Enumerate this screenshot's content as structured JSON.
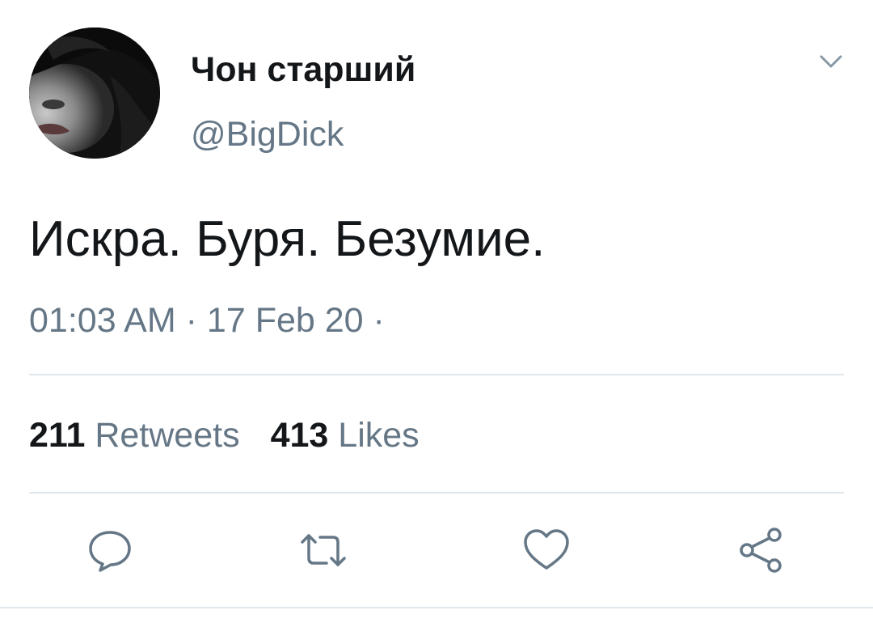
{
  "user": {
    "display_name": "Чон старший",
    "handle": "@BigDick",
    "avatar_icon": "avatar-photo"
  },
  "tweet": {
    "text": "Искра. Буря. Безумие.",
    "time": "01:03 AM",
    "date": "17 Feb 20",
    "separator": "·"
  },
  "stats": {
    "retweets_count": "211",
    "retweets_label": "Retweets",
    "likes_count": "413",
    "likes_label": "Likes"
  },
  "actions": {
    "icons": [
      "reply-icon",
      "retweet-icon",
      "like-icon",
      "share-icon"
    ]
  },
  "colors": {
    "text_primary": "#14171a",
    "text_secondary": "#657786",
    "divider": "#e1e8ed",
    "icon": "#657786"
  }
}
